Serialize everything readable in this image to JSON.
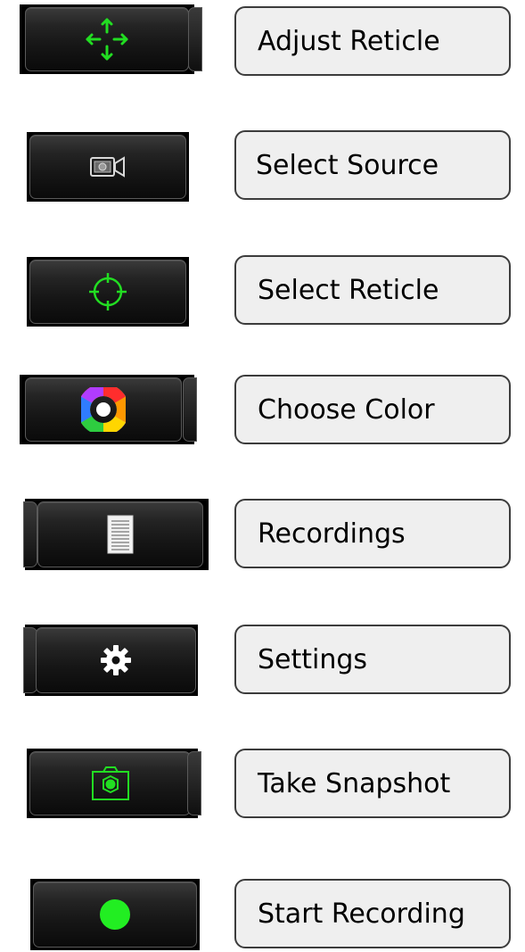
{
  "colors": {
    "accent_green": "#22dd22",
    "button_dark": "#1a1a1a",
    "label_bg": "#efefef"
  },
  "items": [
    {
      "label": "Adjust Reticle",
      "icon": "move-arrows-icon"
    },
    {
      "label": "Select Source",
      "icon": "video-camera-icon"
    },
    {
      "label": "Select Reticle",
      "icon": "crosshair-icon"
    },
    {
      "label": "Choose Color",
      "icon": "color-wheel-icon"
    },
    {
      "label": "Recordings",
      "icon": "document-list-icon"
    },
    {
      "label": "Settings",
      "icon": "gear-icon"
    },
    {
      "label": "Take Snapshot",
      "icon": "camera-icon"
    },
    {
      "label": "Start Recording",
      "icon": "record-dot-icon"
    }
  ]
}
